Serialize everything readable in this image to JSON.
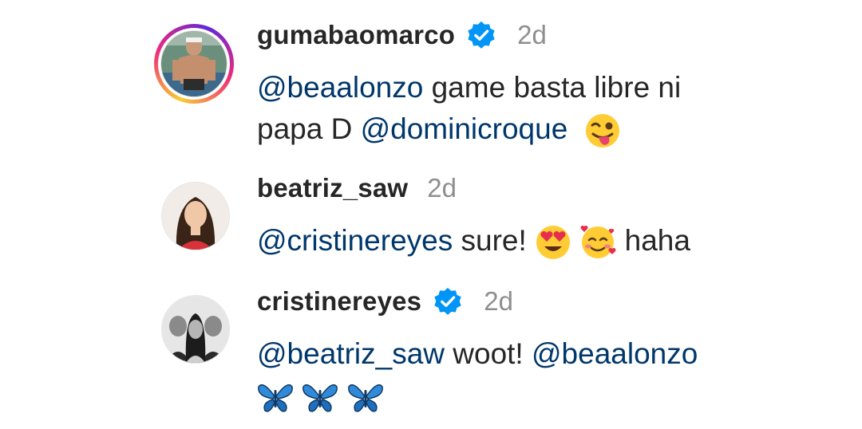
{
  "comments": [
    {
      "username": "gumabaomarco",
      "verified": true,
      "time": "2d",
      "story_ring": true,
      "line1": {
        "mention1": "@beaalonzo",
        "text1": " game basta libre ni"
      },
      "line2": {
        "text2": "papa D ",
        "mention2": "@dominicroque"
      },
      "emoji": [
        "winking-face-with-tongue"
      ]
    },
    {
      "username": "beatriz_saw",
      "verified": false,
      "time": "2d",
      "story_ring": false,
      "line1": {
        "mention1": "@cristinereyes",
        "text1": " sure! ",
        "text2": " haha"
      },
      "emoji": [
        "smiling-face-with-heart-eyes",
        "smiling-face-with-hearts"
      ]
    },
    {
      "username": "cristinereyes",
      "verified": true,
      "time": "2d",
      "story_ring": false,
      "line1": {
        "mention1": "@beatriz_saw",
        "text1": " woot! ",
        "mention2": "@beaalonzo"
      },
      "emoji": [
        "butterfly",
        "butterfly",
        "butterfly"
      ]
    }
  ],
  "colors": {
    "mention": "#00376b",
    "verified": "#0095f6",
    "time": "#8e8e8e",
    "text": "#262626"
  }
}
